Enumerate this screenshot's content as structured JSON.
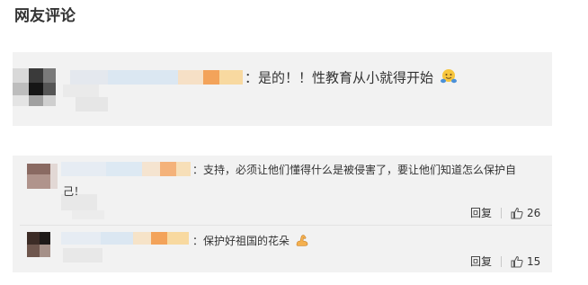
{
  "section_title": "网友评论",
  "comments": [
    {
      "text": "：是的！！性教育从小就得开始",
      "emoji": "hug-emoji"
    },
    {
      "text_line1": "：支持，必须让他们懂得什么是被侵害了，要让他们知道怎么保护自",
      "text_line2": "己！",
      "reply_label": "回复",
      "likes": "26"
    },
    {
      "text": "：保护好祖国的花朵",
      "emoji": "flexed-biceps-emoji",
      "reply_label": "回复",
      "likes": "15"
    }
  ],
  "colors": {
    "card_bg": "#f2f2f2",
    "accent_orange": "#f3a35a",
    "text": "#333333"
  }
}
